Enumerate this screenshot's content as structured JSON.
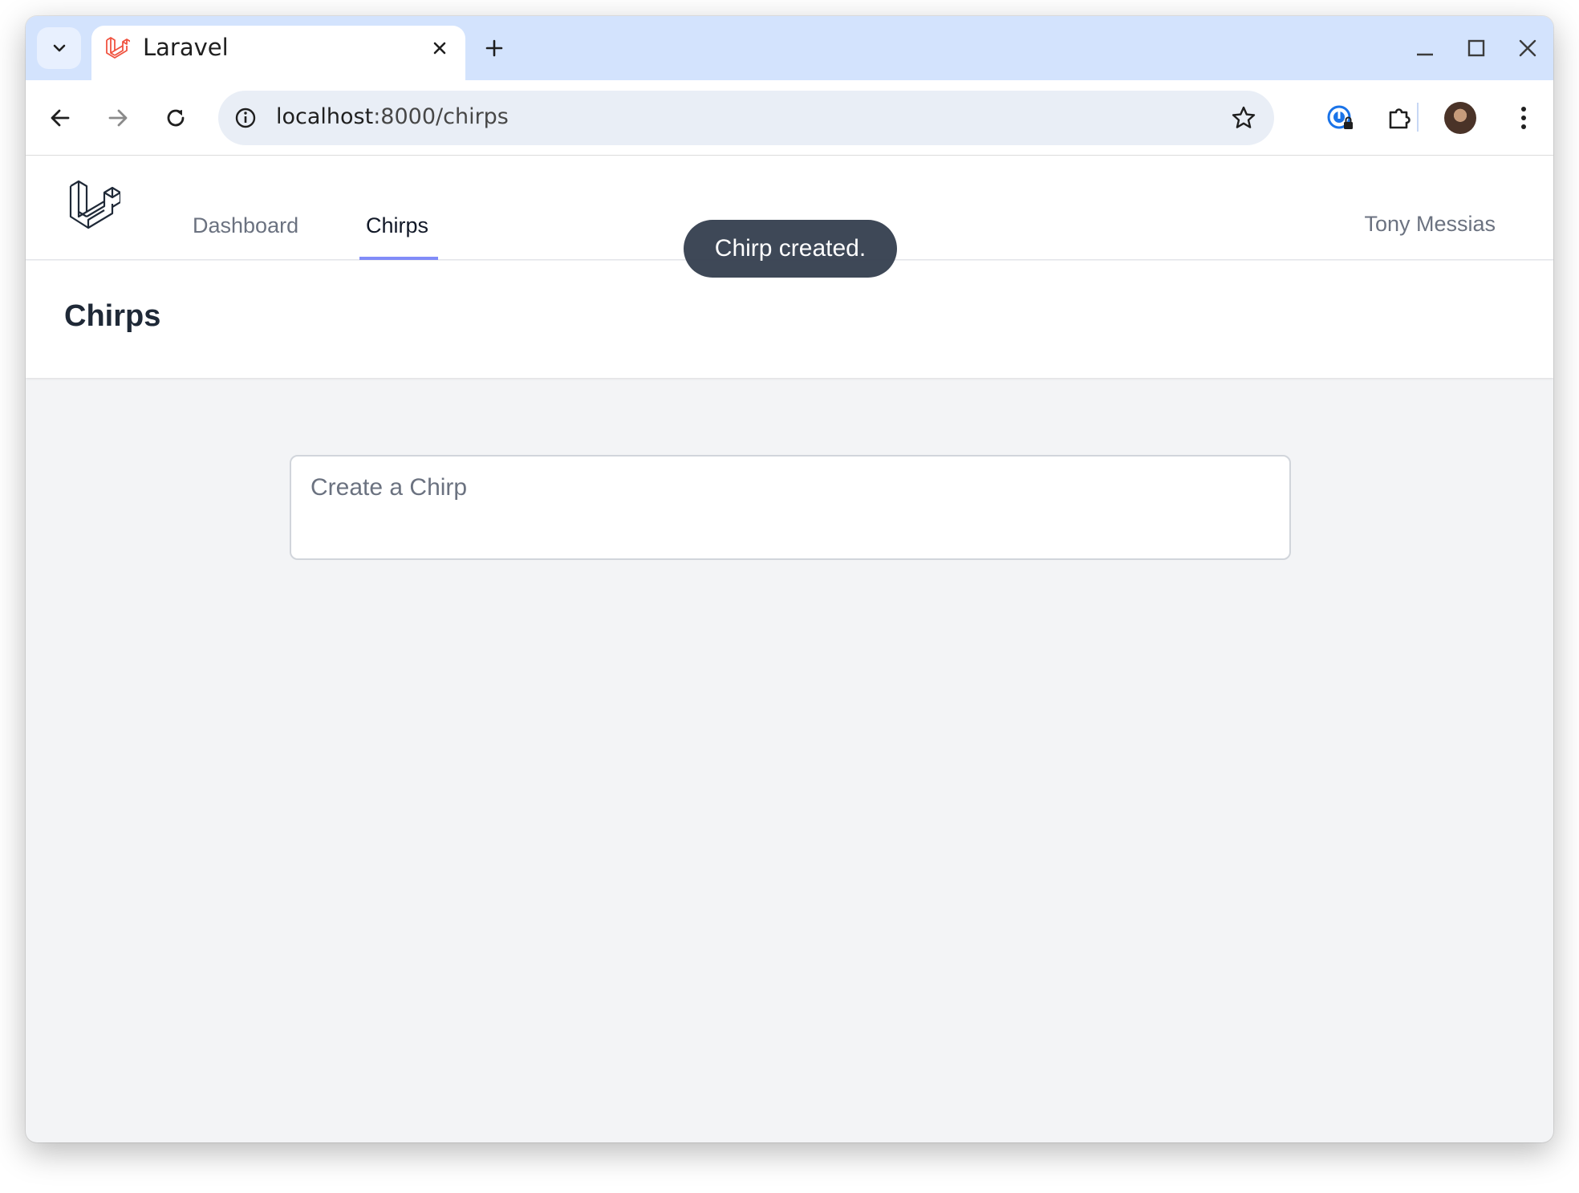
{
  "browser": {
    "tab": {
      "title": "Laravel",
      "favicon": "laravel-logo-icon"
    },
    "address_bar": {
      "host": "localhost",
      "rest": ":8000/chirps"
    },
    "icons": {
      "tab_search": "chevron-down-icon",
      "tab_close": "close-icon",
      "new_tab": "plus-icon",
      "minimize": "minimize-icon",
      "maximize": "maximize-icon",
      "close_window": "close-icon",
      "back": "arrow-left-icon",
      "forward": "arrow-right-icon",
      "reload": "reload-icon",
      "site_info": "info-icon",
      "bookmark": "star-icon",
      "password_manager": "password-manager-icon",
      "extensions": "puzzle-icon",
      "menu": "more-vert-icon"
    },
    "colors": {
      "tabstrip": "#d3e3fd",
      "omnibox": "#e9eef6"
    }
  },
  "app": {
    "nav": {
      "links": [
        {
          "label": "Dashboard",
          "active": false
        },
        {
          "label": "Chirps",
          "active": true
        }
      ],
      "user_name": "Tony Messias"
    },
    "header": {
      "title": "Chirps"
    },
    "toast": {
      "message": "Chirp created."
    },
    "composer": {
      "placeholder": "Create a Chirp",
      "value": ""
    },
    "colors": {
      "accent": "#818cf8",
      "toast_bg": "#374151",
      "page_bg": "#f3f4f6"
    }
  }
}
